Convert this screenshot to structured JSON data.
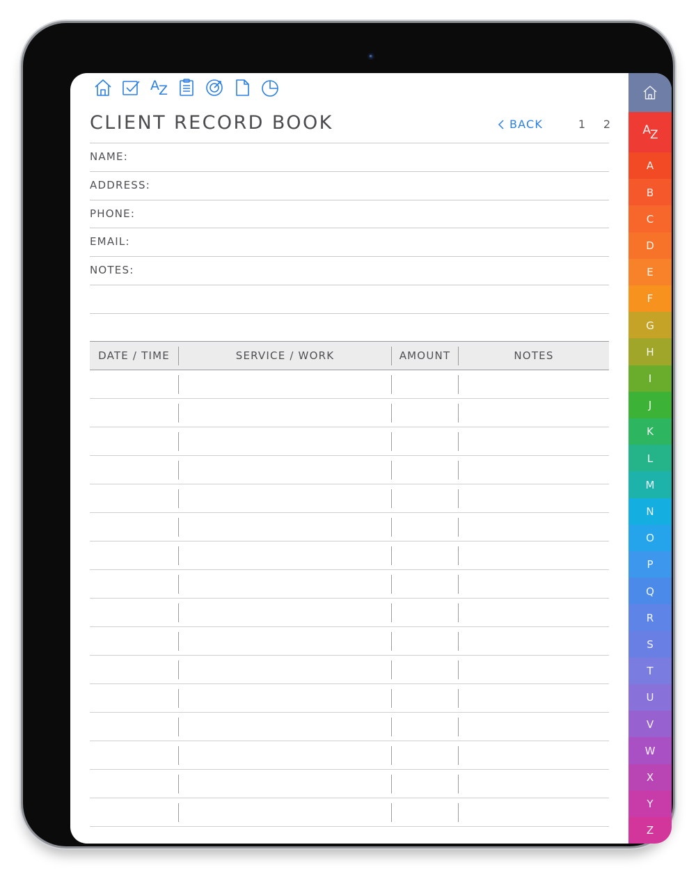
{
  "page": {
    "title": "CLIENT RECORD BOOK",
    "back_label": "BACK",
    "pages": [
      "1",
      "2"
    ]
  },
  "top_nav": [
    {
      "icon": "home-icon"
    },
    {
      "icon": "checkbox-icon"
    },
    {
      "icon": "az-sort-icon",
      "text_a": "A",
      "text_z": "Z"
    },
    {
      "icon": "clipboard-list-icon"
    },
    {
      "icon": "target-icon"
    },
    {
      "icon": "document-icon"
    },
    {
      "icon": "pie-chart-icon"
    }
  ],
  "fields": [
    "NAME:",
    "ADDRESS:",
    "PHONE:",
    "EMAIL:",
    "NOTES:"
  ],
  "table": {
    "headers": [
      "DATE / TIME",
      "SERVICE / WORK",
      "AMOUNT",
      "NOTES"
    ],
    "row_count": 16
  },
  "tabs": {
    "home_icon": "home-icon",
    "az_a": "A",
    "az_z": "Z",
    "letters": [
      "A",
      "B",
      "C",
      "D",
      "E",
      "F",
      "G",
      "H",
      "I",
      "J",
      "K",
      "L",
      "M",
      "N",
      "O",
      "P",
      "Q",
      "R",
      "S",
      "T",
      "U",
      "V",
      "W",
      "X",
      "Y",
      "Z"
    ],
    "colors": [
      "#f24a25",
      "#f5582a",
      "#f7662b",
      "#f8732a",
      "#f7822a",
      "#f6921d",
      "#c5a326",
      "#a0a629",
      "#6aad2c",
      "#3cb336",
      "#2db560",
      "#25b48a",
      "#1db3aa",
      "#14aee0",
      "#25a4ec",
      "#3d97ec",
      "#4c8aea",
      "#5d84e6",
      "#6a7fe4",
      "#7a7ce0",
      "#8871d8",
      "#9762cf",
      "#a951c4",
      "#b944b4",
      "#c73ca8",
      "#d2369a"
    ],
    "home_color": "#6e7ea6",
    "az_color": "#ee3c34"
  },
  "colors": {
    "accent": "#2b7fe3",
    "text": "#4b4b4f",
    "line": "#c9c9cc",
    "header_bg": "#ececec"
  }
}
